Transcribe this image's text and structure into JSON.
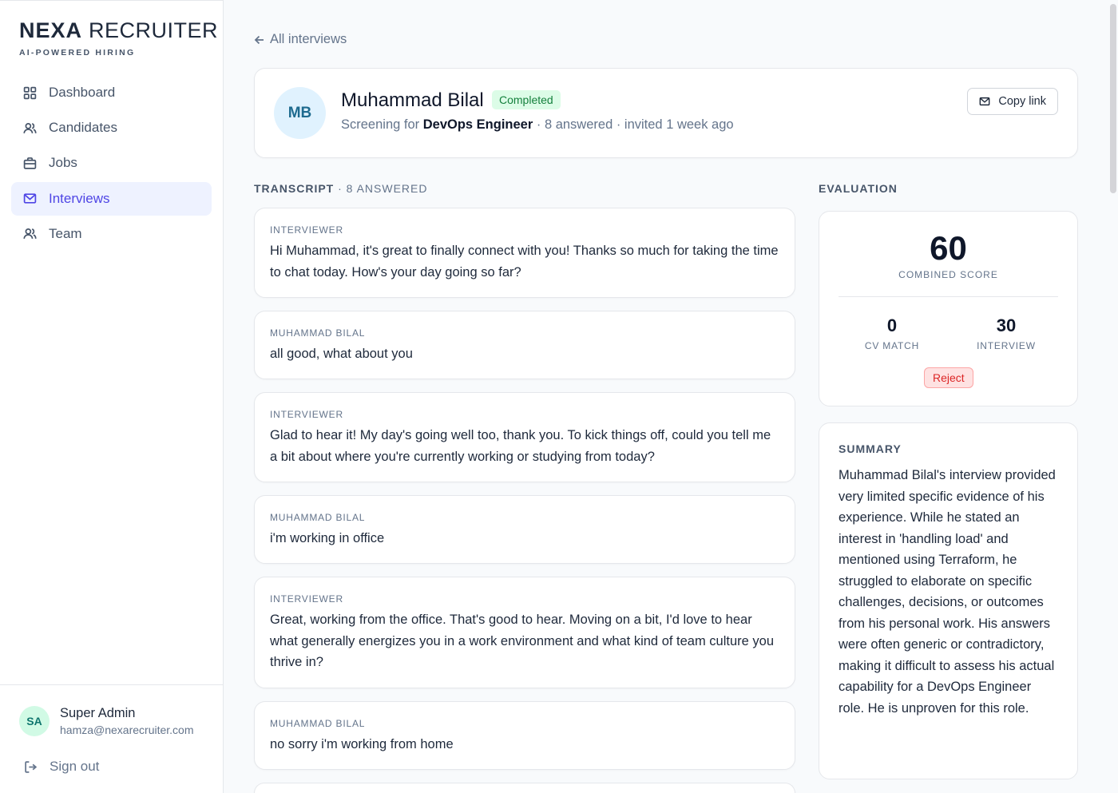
{
  "brand": {
    "name_bold": "NEXA",
    "name_rest": "RECRUITER",
    "tagline": "AI-POWERED HIRING"
  },
  "sidebar": {
    "items": [
      {
        "label": "Dashboard",
        "icon": "grid-icon"
      },
      {
        "label": "Candidates",
        "icon": "users-icon"
      },
      {
        "label": "Jobs",
        "icon": "briefcase-icon"
      },
      {
        "label": "Interviews",
        "icon": "mail-icon",
        "active": true
      },
      {
        "label": "Team",
        "icon": "users-icon"
      }
    ],
    "user": {
      "initials": "SA",
      "name": "Super Admin",
      "email": "hamza@nexarecruiter.com"
    },
    "signout": "Sign out"
  },
  "back": {
    "label": "All interviews"
  },
  "candidate": {
    "initials": "MB",
    "name": "Muhammad Bilal",
    "status": "Completed",
    "meta_prefix": "Screening for ",
    "role": "DevOps Engineer",
    "meta_suffix": " · 8 answered · invited 1 week ago",
    "copy_link": "Copy link"
  },
  "transcript": {
    "label": "TRANSCRIPT",
    "count_label": " · 8 ANSWERED",
    "messages": [
      {
        "role": "INTERVIEWER",
        "text": "Hi Muhammad, it's great to finally connect with you! Thanks so much for taking the time to chat today. How's your day going so far?"
      },
      {
        "role": "MUHAMMAD BILAL",
        "text": "all good, what about you"
      },
      {
        "role": "INTERVIEWER",
        "text": "Glad to hear it! My day's going well too, thank you. To kick things off, could you tell me a bit about where you're currently working or studying from today?"
      },
      {
        "role": "MUHAMMAD BILAL",
        "text": "i'm working in office"
      },
      {
        "role": "INTERVIEWER",
        "text": "Great, working from the office. That's good to hear. Moving on a bit, I'd love to hear what generally energizes you in a work environment and what kind of team culture you thrive in?"
      },
      {
        "role": "MUHAMMAD BILAL",
        "text": "no sorry i'm working from home"
      }
    ]
  },
  "evaluation": {
    "label": "EVALUATION",
    "combined_score": "60",
    "combined_label": "COMBINED SCORE",
    "cv_match": "0",
    "cv_match_label": "CV MATCH",
    "interview": "30",
    "interview_label": "INTERVIEW",
    "verdict": "Reject"
  },
  "summary": {
    "label": "SUMMARY",
    "text": "Muhammad Bilal's interview provided very limited specific evidence of his experience. While he stated an interest in 'handling load' and mentioned using Terraform, he struggled to elaborate on specific challenges, decisions, or outcomes from his personal work. His answers were often generic or contradictory, making it difficult to assess his actual capability for a DevOps Engineer role. He is unproven for this role."
  },
  "colors": {
    "accent": "#4f46e5",
    "success": "#15803d",
    "danger": "#dc2626"
  }
}
